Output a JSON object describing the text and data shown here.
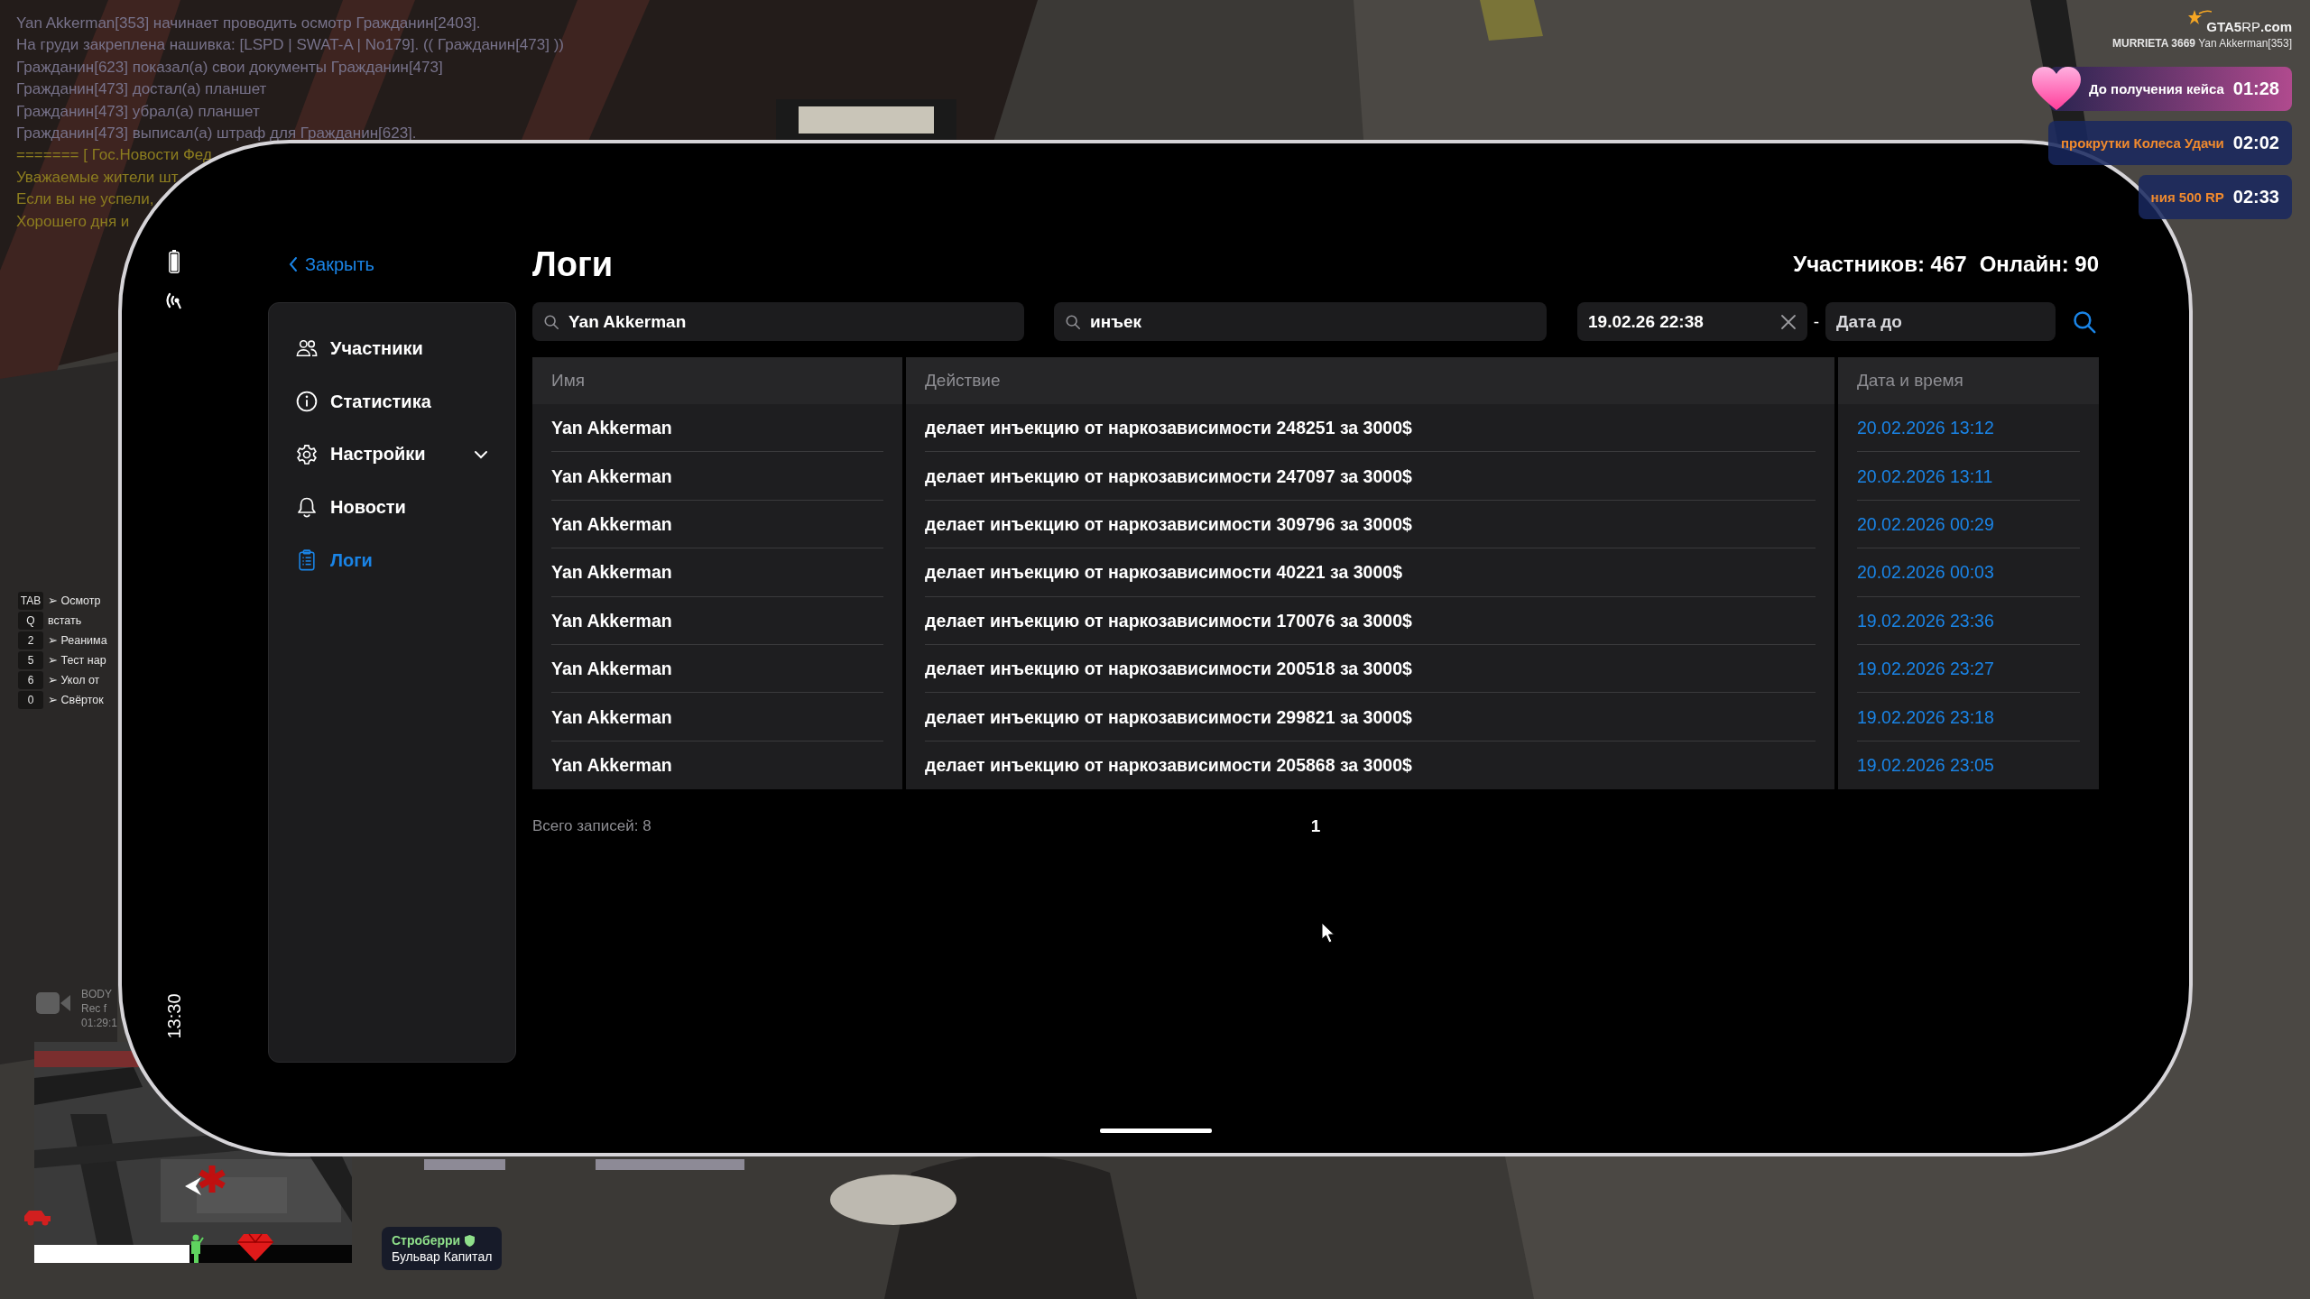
{
  "chat": [
    {
      "text": "Yan Akkerman[353] начинает проводить осмотр Гражданин[2403].",
      "kind": "system"
    },
    {
      "text": "На груди закреплена нашивка: [LSPD | SWAT-A | No179]. (( Гражданин[473] ))",
      "kind": "system"
    },
    {
      "text": "Гражданин[623] показал(а) свои документы Гражданин[473]",
      "kind": "system"
    },
    {
      "text": "Гражданин[473] достал(а) планшет",
      "kind": "system"
    },
    {
      "text": "Гражданин[473] убрал(а) планшет",
      "kind": "system"
    },
    {
      "text": "Гражданин[473] выписал(а) штраф для Гражданин[623].",
      "kind": "system"
    },
    {
      "text": "======= [ Гос.Новости Фед",
      "kind": "news"
    },
    {
      "text": "Уважаемые жители шт",
      "kind": "news"
    },
    {
      "text": "Если вы не успели,",
      "kind": "news"
    },
    {
      "text": "Хорошего дня и",
      "kind": "news"
    }
  ],
  "brand": {
    "logo": "**GTA5**RP**.com**",
    "player": "**MURRIETA 3669** Yan Akkerman[353]"
  },
  "timers": [
    {
      "label": "До получения кейса",
      "time": "01:28",
      "kind": "case"
    },
    {
      "label": "прокрутки Колеса Удачи",
      "time": "02:02",
      "kind": "bonus"
    },
    {
      "label": "ния 500 RP",
      "time": "02:33",
      "kind": "bonus"
    }
  ],
  "hotkeys": [
    {
      "key": "TAB",
      "action": "➢ Осмотр"
    },
    {
      "key": "Q",
      "action": "встать"
    },
    {
      "key": "2",
      "action": "➢ Реанима"
    },
    {
      "key": "5",
      "action": "➢ Тест нар"
    },
    {
      "key": "6",
      "action": "➢ Укол от"
    },
    {
      "key": "0",
      "action": "➢ Свёрток"
    }
  ],
  "bodycam": {
    "lines": [
      "BODY",
      "Rec f",
      "01:29:1"
    ]
  },
  "minimap": {
    "health_bar": {
      "level": 0.49
    }
  },
  "location": {
    "area": "Строберри",
    "street": "Бульвар Капитал"
  },
  "phone": {
    "time": "13:30",
    "back": "Закрыть",
    "title": "Логи",
    "stats": [
      "Участников: 467",
      "Онлайн: 90"
    ],
    "sidebar": [
      {
        "label": "Участники",
        "selected": false,
        "expandable": false
      },
      {
        "label": "Статистика",
        "selected": false,
        "expandable": false
      },
      {
        "label": "Настройки",
        "selected": false,
        "expandable": true
      },
      {
        "label": "Новости",
        "selected": false,
        "expandable": false
      },
      {
        "label": "Логи",
        "selected": true,
        "expandable": false
      }
    ],
    "filters": {
      "name": {
        "value": "Yan Akkerman"
      },
      "action": {
        "value": "инъек"
      },
      "date_from": {
        "value": "19.02.26 22:38"
      },
      "separator": "-",
      "date_to": {
        "placeholder": "Дата до"
      }
    },
    "table": {
      "columns": [
        {
          "label": "Имя",
          "kind": "text"
        },
        {
          "label": "Действие",
          "kind": "text"
        },
        {
          "label": "Дата и время",
          "kind": "date"
        }
      ],
      "rows": [
        [
          "Yan Akkerman",
          "делает инъекцию от наркозависимости 248251 за 3000$",
          "20.02.2026 13:12"
        ],
        [
          "Yan Akkerman",
          "делает инъекцию от наркозависимости 247097 за 3000$",
          "20.02.2026 13:11"
        ],
        [
          "Yan Akkerman",
          "делает инъекцию от наркозависимости 309796 за 3000$",
          "20.02.2026 00:29"
        ],
        [
          "Yan Akkerman",
          "делает инъекцию от наркозависимости 40221 за 3000$",
          "20.02.2026 00:03"
        ],
        [
          "Yan Akkerman",
          "делает инъекцию от наркозависимости 170076 за 3000$",
          "19.02.2026 23:36"
        ],
        [
          "Yan Akkerman",
          "делает инъекцию от наркозависимости 200518 за 3000$",
          "19.02.2026 23:27"
        ],
        [
          "Yan Akkerman",
          "делает инъекцию от наркозависимости 299821 за 3000$",
          "19.02.2026 23:18"
        ],
        [
          "Yan Akkerman",
          "делает инъекцию от наркозависимости 205868 за 3000$",
          "19.02.2026 23:05"
        ]
      ]
    },
    "total": "Всего записей: 8",
    "pages": [
      {
        "label": "1",
        "selected": true
      }
    ]
  }
}
